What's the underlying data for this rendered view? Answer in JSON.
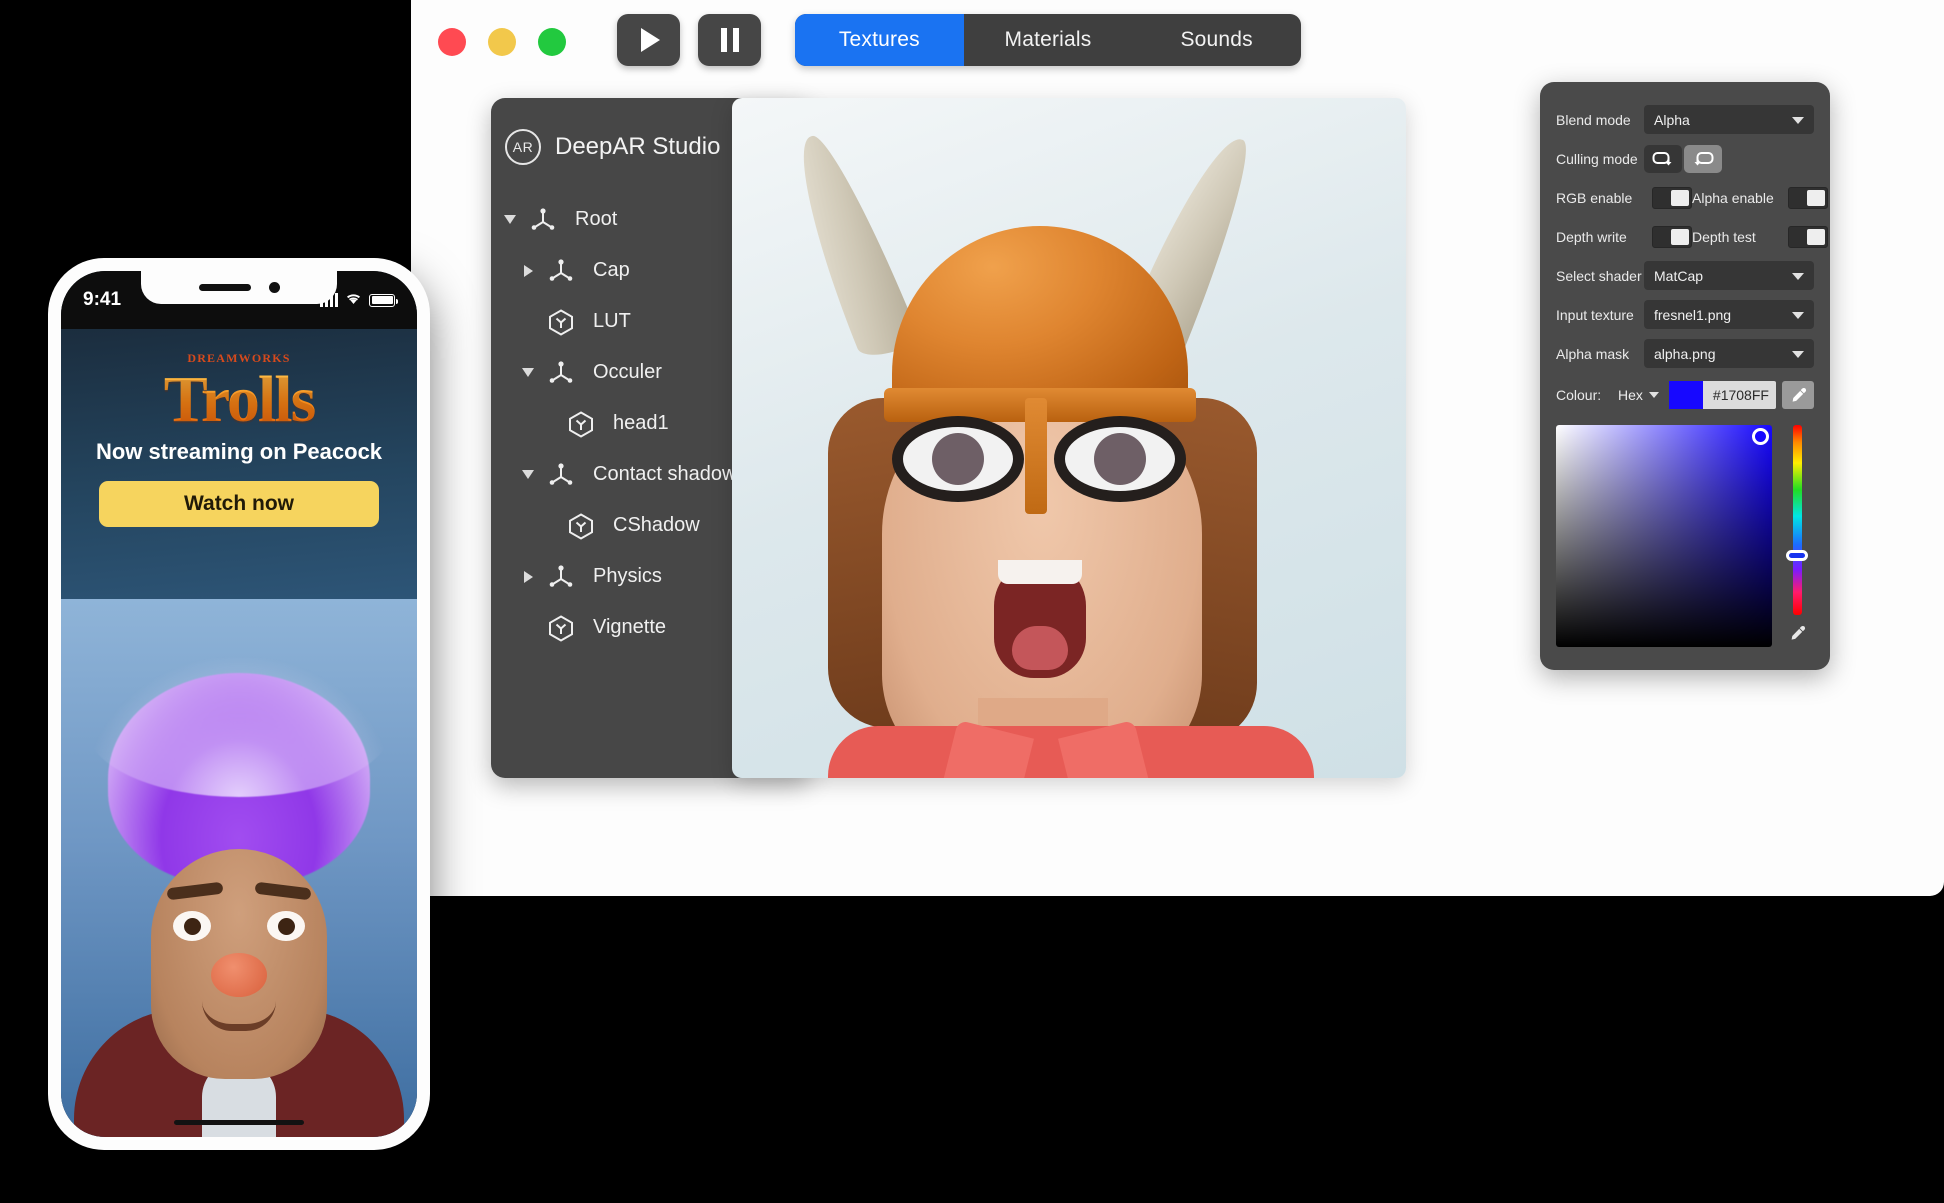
{
  "window": {
    "traffic_lights": [
      {
        "name": "close",
        "color": "#FF4A52"
      },
      {
        "name": "minimize",
        "color": "#F2C84B"
      },
      {
        "name": "maximize",
        "color": "#22C93F"
      }
    ],
    "transport": {
      "play_icon": "play-icon",
      "pause_icon": "pause-icon"
    },
    "tabs": [
      {
        "label": "Textures",
        "active": true
      },
      {
        "label": "Materials",
        "active": false
      },
      {
        "label": "Sounds",
        "active": false
      }
    ],
    "accent_color": "#1A73F2"
  },
  "tree_panel": {
    "badge": "AR",
    "title": "DeepAR Studio",
    "nodes": [
      {
        "label": "Root",
        "depth": 0,
        "icon": "axis-icon",
        "twisty": "down"
      },
      {
        "label": "Cap",
        "depth": 1,
        "icon": "axis-icon",
        "twisty": "right"
      },
      {
        "label": "LUT",
        "depth": 1,
        "icon": "cube-icon",
        "twisty": "none"
      },
      {
        "label": "Occuler",
        "depth": 1,
        "icon": "axis-icon",
        "twisty": "down"
      },
      {
        "label": "head1",
        "depth": 2,
        "icon": "cube-icon",
        "twisty": "none"
      },
      {
        "label": "Contact shadow",
        "depth": 1,
        "icon": "axis-icon",
        "twisty": "down"
      },
      {
        "label": "CShadow",
        "depth": 2,
        "icon": "cube-icon",
        "twisty": "none"
      },
      {
        "label": "Physics",
        "depth": 1,
        "icon": "axis-icon",
        "twisty": "right"
      },
      {
        "label": "Vignette",
        "depth": 1,
        "icon": "cube-icon",
        "twisty": "none"
      }
    ]
  },
  "preview": {
    "description": "AR viking helmet filter preview"
  },
  "properties": {
    "blend_mode": {
      "label": "Blend mode",
      "value": "Alpha"
    },
    "culling_mode": {
      "label": "Culling mode",
      "options": [
        "cull-front-icon",
        "cull-back-icon"
      ],
      "selected_index": 1
    },
    "rgb_enable": {
      "label": "RGB enable",
      "on": true
    },
    "alpha_enable": {
      "label": "Alpha enable",
      "on": true
    },
    "depth_write": {
      "label": "Depth write",
      "on": true
    },
    "depth_test": {
      "label": "Depth test",
      "on": true
    },
    "select_shader": {
      "label": "Select shader",
      "value": "MatCap"
    },
    "input_texture": {
      "label": "Input texture",
      "value": "fresnel1.png"
    },
    "alpha_mask": {
      "label": "Alpha mask",
      "value": "alpha.png"
    },
    "colour": {
      "label": "Colour:",
      "format": "Hex",
      "hex": "#1708FF",
      "swatch_color": "#1708FF",
      "eyedropper_icon": "eyedropper-icon"
    }
  },
  "phone": {
    "status_bar": {
      "time": "9:41",
      "signal_icon": "signal-bars-icon",
      "wifi_icon": "wifi-icon",
      "battery_icon": "battery-icon"
    },
    "ad": {
      "studio_logo": "DREAMWORKS",
      "title": "Trolls",
      "subtitle": "Now streaming on Peacock",
      "cta_label": "Watch now",
      "cta_color": "#F6D45E"
    },
    "camera_view": {
      "description": "Troll filter with purple hair on live camera"
    }
  }
}
